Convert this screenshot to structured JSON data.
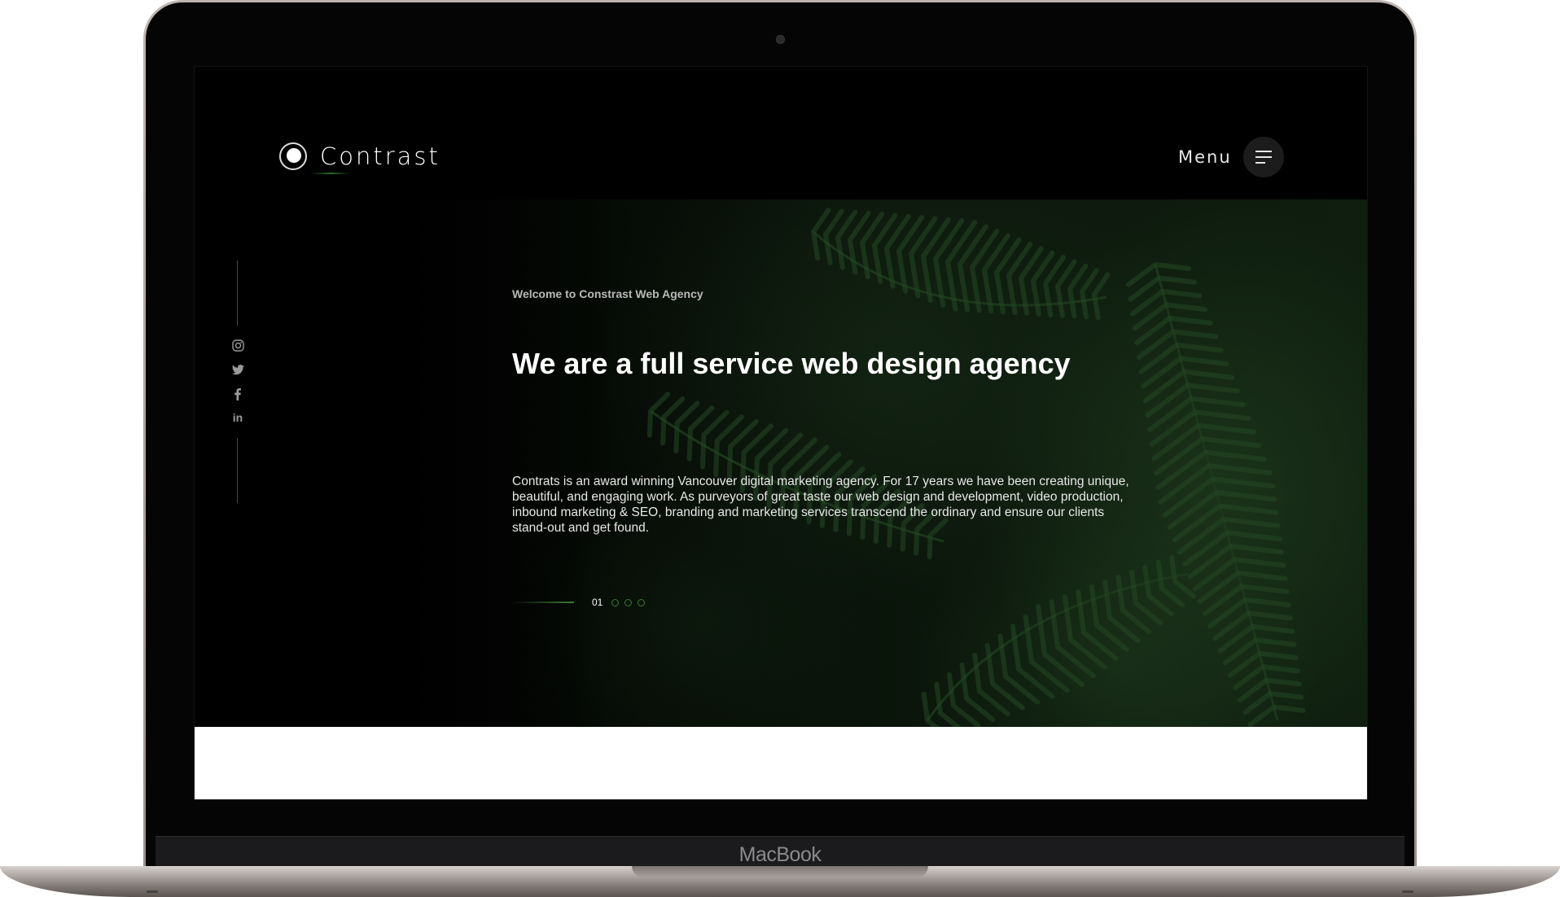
{
  "device": {
    "brand_label": "MacBook"
  },
  "site": {
    "logo_text": "Contrast",
    "menu_label": "Menu",
    "social": [
      {
        "name": "instagram-icon"
      },
      {
        "name": "twitter-icon"
      },
      {
        "name": "facebook-icon"
      },
      {
        "name": "linkedin-icon"
      }
    ]
  },
  "hero": {
    "eyebrow": "Welcome to Constrast Web Agency",
    "headline": "We are a full service web design agency",
    "body": "Contrats is an award winning Vancouver digital marketing agency. For 17 years we have been creating unique, beautiful, and engaging work. As purveyors of great taste our web design and development, video production, inbound marketing & SEO, branding and marketing services transcend the ordinary and ensure our clients stand-out and get found.",
    "slider_current": "01",
    "slider_total_dots": 3
  },
  "colors": {
    "accent": "#3c7a34",
    "background": "#000000",
    "text": "#ffffff"
  }
}
